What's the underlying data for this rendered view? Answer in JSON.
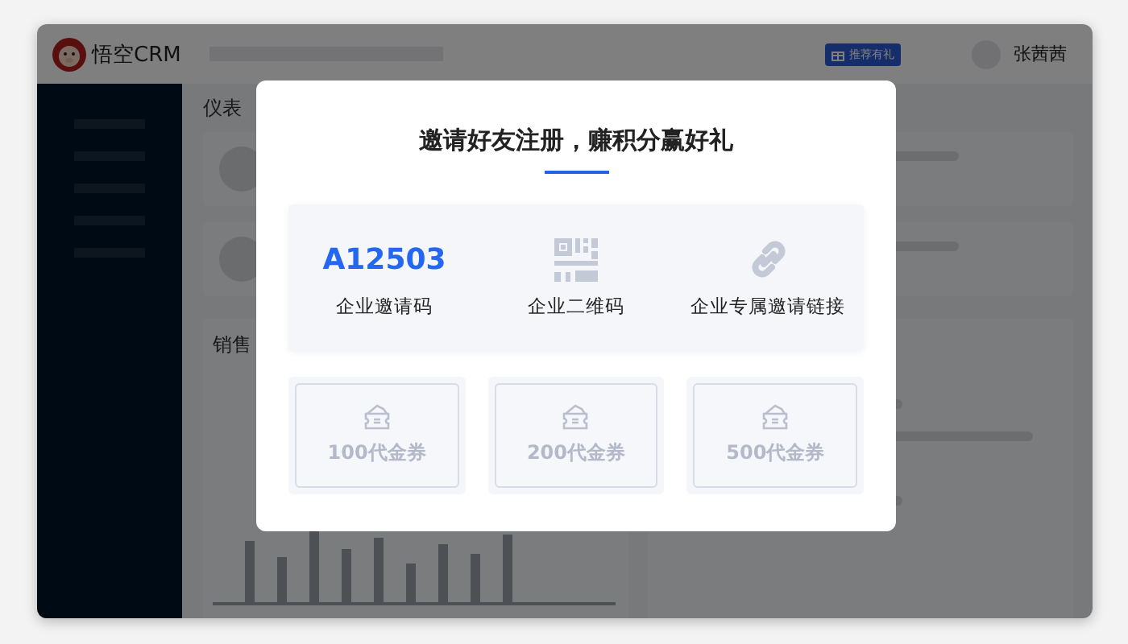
{
  "app": {
    "logo_text": "悟空CRM",
    "promo_badge": "推荐有礼",
    "user_name": "张茜茜"
  },
  "background": {
    "dashboard_heading": "仪表",
    "sales_heading": "销售"
  },
  "modal": {
    "title": "邀请好友注册，赚积分赢好礼",
    "invite_options": [
      {
        "kind": "code",
        "value": "A12503",
        "label": "企业邀请码"
      },
      {
        "kind": "qrcode",
        "label": "企业二维码"
      },
      {
        "kind": "link",
        "label": "企业专属邀请链接"
      }
    ],
    "vouchers": [
      {
        "label": "100代金券"
      },
      {
        "label": "200代金券"
      },
      {
        "label": "500代金券"
      }
    ]
  }
}
